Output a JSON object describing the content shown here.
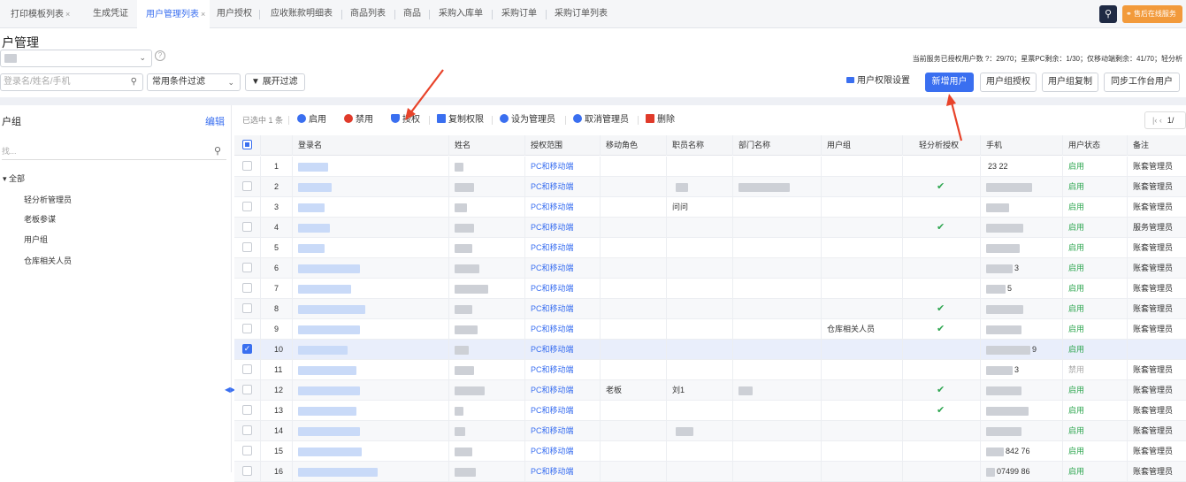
{
  "tabs": [
    {
      "label": "打印模板列表",
      "closable": true,
      "active": false
    },
    {
      "label": "生成凭证",
      "closable": false,
      "active": false
    },
    {
      "label": "用户管理列表",
      "closable": true,
      "active": true
    },
    {
      "label": "用户授权",
      "closable": false,
      "active": false
    },
    {
      "label": "应收账款明细表",
      "closable": false,
      "active": false
    },
    {
      "label": "商品列表",
      "closable": false,
      "active": false
    },
    {
      "label": "商品",
      "closable": false,
      "active": false
    },
    {
      "label": "采购入库单",
      "closable": false,
      "active": false
    },
    {
      "label": "采购订单",
      "closable": false,
      "active": false
    },
    {
      "label": "采购订单列表",
      "closable": false,
      "active": false
    }
  ],
  "service_btn": "售后在线服务",
  "page_title": "户管理",
  "filters": {
    "search_placeholder": "登录名/姓名/手机",
    "preset": "常用条件过滤",
    "expand": "展开过滤"
  },
  "stats": "当前服务已授权用户数 ?：29/70；星票PC剩余：1/30；仅移动端剩余：41/70；轻分析",
  "header_buttons": {
    "perm_settings": "用户权限设置",
    "new_user": "新增用户",
    "group_auth": "用户组授权",
    "group_copy": "用户组复制",
    "sync": "同步工作台用户"
  },
  "left": {
    "title": "户组",
    "edit": "编辑",
    "search_placeholder": "找...",
    "tree": {
      "root": "全部",
      "children": [
        "轻分析管理员",
        "老板参谋",
        "用户组",
        "仓库相关人员"
      ]
    }
  },
  "toolbar": {
    "selected": "已选中 1 条",
    "enable": "启用",
    "disable": "禁用",
    "authorize": "授权",
    "copy_perm": "复制权限",
    "set_admin": "设为管理员",
    "cancel_admin": "取消管理员",
    "delete": "删除"
  },
  "pager": {
    "prev": "|‹ ‹",
    "page": "1/"
  },
  "columns": [
    "登录名",
    "姓名",
    "授权范围",
    "移动角色",
    "职员名称",
    "部门名称",
    "用户组",
    "轻分析授权",
    "手机",
    "用户状态",
    "备注"
  ],
  "rows": [
    {
      "n": "1",
      "scope": "PC和移动端",
      "mobile_role": "",
      "staff": "",
      "group": "",
      "analysis": false,
      "phone": "23 22",
      "status": "启用",
      "note": "账套管理员",
      "checked": false
    },
    {
      "n": "2",
      "scope": "PC和移动端",
      "mobile_role": "",
      "staff": "",
      "group": "",
      "analysis": true,
      "phone": "",
      "status": "启用",
      "note": "账套管理员",
      "checked": false
    },
    {
      "n": "3",
      "scope": "PC和移动端",
      "mobile_role": "",
      "staff": "问问",
      "group": "",
      "analysis": false,
      "phone": "",
      "status": "启用",
      "note": "账套管理员",
      "checked": false
    },
    {
      "n": "4",
      "scope": "PC和移动端",
      "mobile_role": "",
      "staff": "",
      "group": "",
      "analysis": true,
      "phone": "",
      "status": "启用",
      "note": "服务管理员",
      "checked": false
    },
    {
      "n": "5",
      "scope": "PC和移动端",
      "mobile_role": "",
      "staff": "",
      "group": "",
      "analysis": false,
      "phone": "",
      "status": "启用",
      "note": "账套管理员",
      "checked": false
    },
    {
      "n": "6",
      "scope": "PC和移动端",
      "mobile_role": "",
      "staff": "",
      "group": "",
      "analysis": false,
      "phone": "3",
      "status": "启用",
      "note": "账套管理员",
      "checked": false
    },
    {
      "n": "7",
      "scope": "PC和移动端",
      "mobile_role": "",
      "staff": "",
      "group": "",
      "analysis": false,
      "phone": "5",
      "status": "启用",
      "note": "账套管理员",
      "checked": false
    },
    {
      "n": "8",
      "scope": "PC和移动端",
      "mobile_role": "",
      "staff": "",
      "group": "",
      "analysis": true,
      "phone": "",
      "status": "启用",
      "note": "账套管理员",
      "checked": false
    },
    {
      "n": "9",
      "scope": "PC和移动端",
      "mobile_role": "",
      "staff": "",
      "group": "仓库相关人员",
      "analysis": true,
      "phone": "",
      "status": "启用",
      "note": "账套管理员",
      "checked": false
    },
    {
      "n": "10",
      "scope": "PC和移动端",
      "mobile_role": "",
      "staff": "",
      "group": "",
      "analysis": false,
      "phone": "9",
      "status": "启用",
      "note": "",
      "checked": true
    },
    {
      "n": "11",
      "scope": "PC和移动端",
      "mobile_role": "",
      "staff": "",
      "group": "",
      "analysis": false,
      "phone": "3",
      "status": "禁用",
      "note": "账套管理员",
      "checked": false
    },
    {
      "n": "12",
      "scope": "PC和移动端",
      "mobile_role": "老板",
      "staff": "刘1",
      "group": "",
      "analysis": true,
      "phone": "",
      "status": "启用",
      "note": "账套管理员",
      "checked": false
    },
    {
      "n": "13",
      "scope": "PC和移动端",
      "mobile_role": "",
      "staff": "",
      "group": "",
      "analysis": true,
      "phone": "",
      "status": "启用",
      "note": "账套管理员",
      "checked": false
    },
    {
      "n": "14",
      "scope": "PC和移动端",
      "mobile_role": "",
      "staff": "",
      "group": "",
      "analysis": false,
      "phone": "",
      "status": "启用",
      "note": "账套管理员",
      "checked": false
    },
    {
      "n": "15",
      "scope": "PC和移动端",
      "mobile_role": "",
      "staff": "",
      "group": "",
      "analysis": false,
      "phone": "842 76",
      "status": "启用",
      "note": "账套管理员",
      "checked": false
    },
    {
      "n": "16",
      "scope": "PC和移动端",
      "mobile_role": "",
      "staff": "",
      "group": "",
      "analysis": false,
      "phone": "07499 86",
      "status": "启用",
      "note": "账套管理员",
      "checked": false
    }
  ],
  "colors": {
    "accent": "#3a6ff0",
    "enabled": "#2ea650",
    "annotation": "#e8432a"
  }
}
